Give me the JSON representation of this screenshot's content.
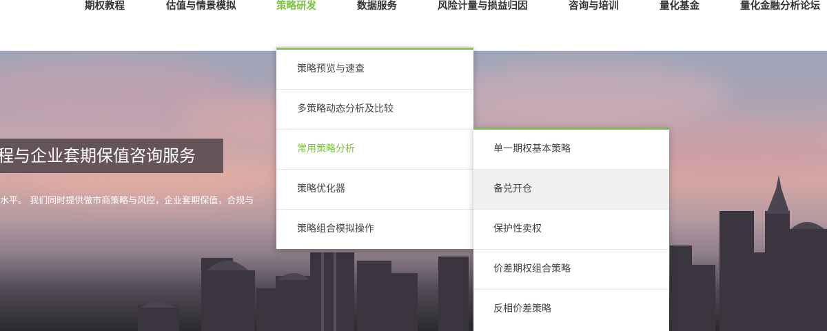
{
  "nav": {
    "items": [
      {
        "label": "期权教程",
        "active": false
      },
      {
        "label": "估值与情景模拟",
        "active": false
      },
      {
        "label": "策略研发",
        "active": true
      },
      {
        "label": "数据服务",
        "active": false
      },
      {
        "label": "风险计量与损益归因",
        "active": false
      },
      {
        "label": "咨询与培训",
        "active": false
      },
      {
        "label": "量化基金",
        "active": false
      },
      {
        "label": "量化金融分析论坛",
        "active": false
      }
    ]
  },
  "hero": {
    "title": "程与企业套期保值咨询服务",
    "subtitle": "水平。 我们同时提供做市商策略与风控，企业套期保值，合规与"
  },
  "dropdown": {
    "items": [
      {
        "label": "策略预览与速查"
      },
      {
        "label": "多策略动态分析及比较"
      },
      {
        "label": "常用策略分析",
        "active": true
      },
      {
        "label": "策略优化器"
      },
      {
        "label": "策略组合模拟操作"
      }
    ]
  },
  "submenu": {
    "items": [
      {
        "label": "单一期权基本策略"
      },
      {
        "label": "备兑开仓",
        "hovered": true
      },
      {
        "label": "保护性卖权"
      },
      {
        "label": "价差期权组合策略"
      },
      {
        "label": "反相价差策略"
      }
    ]
  },
  "colors": {
    "accent": "#7cc242",
    "text": "#333333",
    "hover_bg": "#f0f0f0"
  }
}
